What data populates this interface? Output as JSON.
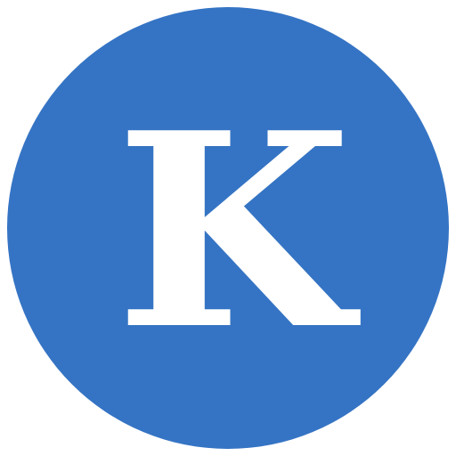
{
  "logo": {
    "letter": "K",
    "background_color": "#3574c4",
    "letter_color": "#ffffff",
    "shape": "circle"
  }
}
